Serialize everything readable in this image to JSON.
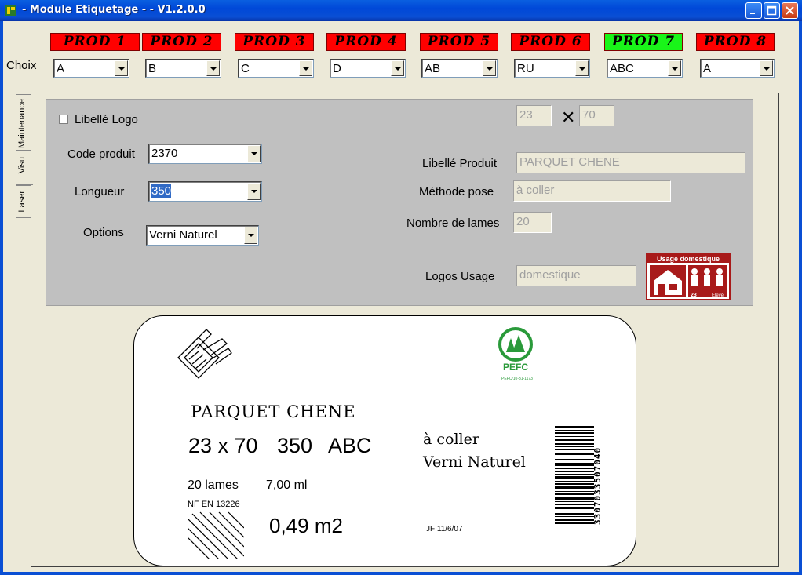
{
  "window": {
    "title": "- Module Etiquetage - - V1.2.0.0",
    "icon": "app-icon"
  },
  "prod_buttons": [
    {
      "label": "PROD 1",
      "color": "#ff0000"
    },
    {
      "label": "PROD 2",
      "color": "#ff0000"
    },
    {
      "label": "PROD 3",
      "color": "#ff0000"
    },
    {
      "label": "PROD 4",
      "color": "#ff0000"
    },
    {
      "label": "PROD 5",
      "color": "#ff0000"
    },
    {
      "label": "PROD 6",
      "color": "#ff0000"
    },
    {
      "label": "PROD 7",
      "color": "#19f519"
    },
    {
      "label": "PROD 8",
      "color": "#ff0000"
    }
  ],
  "choix": {
    "label": "Choix",
    "values": [
      "A",
      "B",
      "C",
      "D",
      "AB",
      "RU",
      "ABC",
      "A"
    ]
  },
  "tabs": [
    "Maintenance",
    "Visu",
    "Laser"
  ],
  "form": {
    "libelle_logo_label": "Libellé Logo",
    "libelle_logo_checked": false,
    "code_produit_label": "Code produit",
    "code_produit_value": "2370",
    "longueur_label": "Longueur",
    "longueur_value": "350",
    "options_label": "Options",
    "options_value": "Verni Naturel",
    "dim_width": "23",
    "dim_height": "70",
    "libelle_produit_label": "Libellé Produit",
    "libelle_produit_value": "PARQUET CHENE",
    "methode_pose_label": "Méthode pose",
    "methode_pose_value": "à coller",
    "nombre_lames_label": "Nombre de lames",
    "nombre_lames_value": "20",
    "logos_usage_label": "Logos Usage",
    "logos_usage_value": "domestique",
    "logo_usage_badge": {
      "title": "Usage domestique",
      "code": "23",
      "grade": "Elevé"
    }
  },
  "label_preview": {
    "product": "PARQUET CHENE",
    "dims": "23 x 70",
    "length": "350",
    "choix": "ABC",
    "pose": "à coller",
    "finish": "Verni Naturel",
    "lames": "20 lames",
    "ml": "7,00 ml",
    "norm": "NF EN 13226",
    "area": "0,49 m2",
    "barcode_number": "3307033507040",
    "small_code": "JF 11/6/07",
    "pefc": "PEFC",
    "pefc_sub": "PEFC/10-31-1173"
  }
}
